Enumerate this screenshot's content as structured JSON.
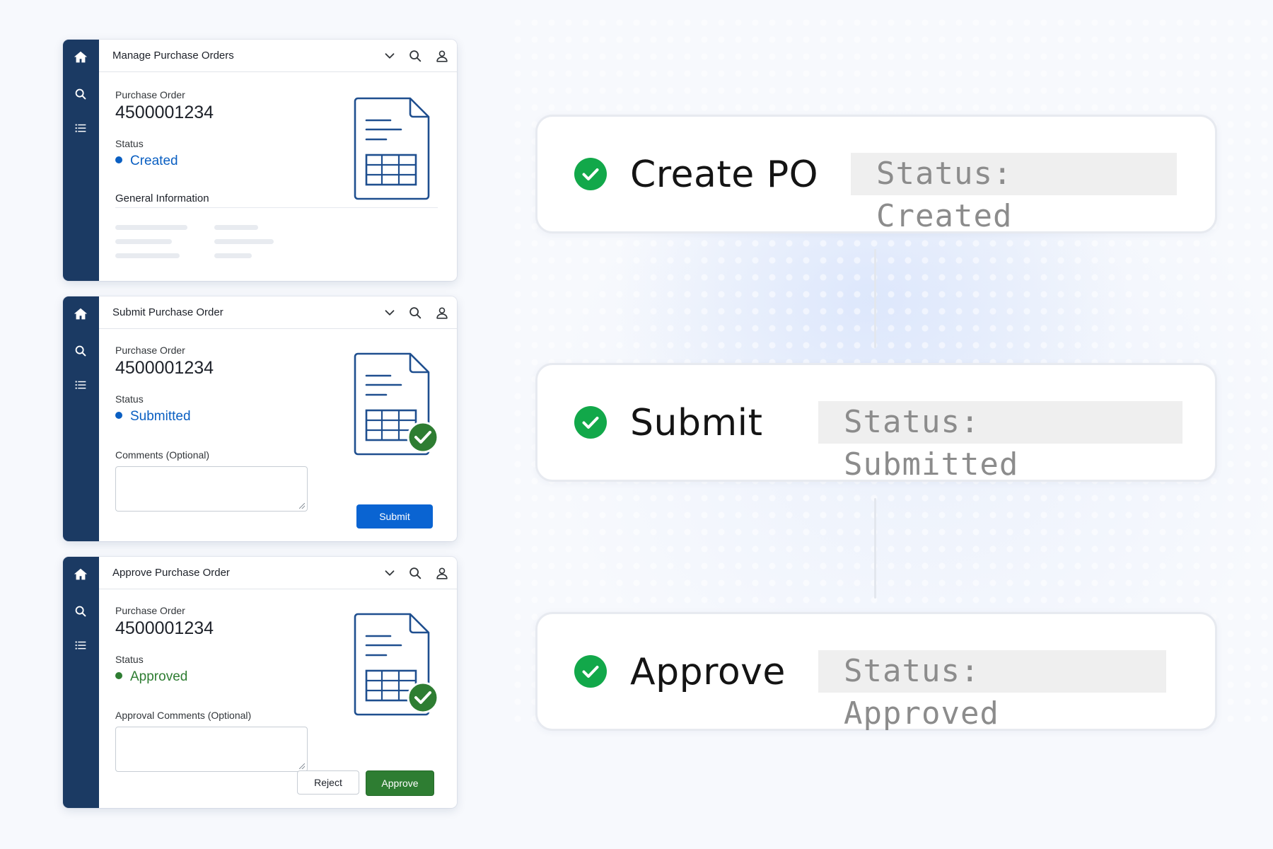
{
  "panels": [
    {
      "header_title": "Manage Purchase Orders",
      "po_label": "Purchase Order",
      "po_number": "4500001234",
      "status_label": "Status",
      "status_value": "Created",
      "section_title": "General Information"
    },
    {
      "header_title": "Submit Purchase Order",
      "po_label": "Purchase Order",
      "po_number": "4500001234",
      "status_label": "Status",
      "status_value": "Submitted",
      "comments_label": "Comments (Optional)",
      "submit_label": "Submit"
    },
    {
      "header_title": "Approve Purchase Order",
      "po_label": "Purchase Order",
      "po_number": "4500001234",
      "status_label": "Status",
      "status_value": "Approved",
      "comments_label": "Approval Comments (Optional)",
      "reject_label": "Reject",
      "approve_label": "Approve"
    }
  ],
  "steps": [
    {
      "title": "Create PO",
      "status_text": "Status: Created"
    },
    {
      "title": "Submit",
      "status_text": "Status: Submitted"
    },
    {
      "title": "Approve",
      "status_text": "Status: Approved"
    }
  ],
  "icons": {
    "rail": [
      "home-icon",
      "search-icon",
      "list-icon"
    ],
    "header": [
      "chevron-down-icon",
      "search-icon",
      "user-icon"
    ],
    "document": "document-table-icon",
    "step_check": "check-circle-icon"
  },
  "colors": {
    "rail": "#1b3a63",
    "status_blue": "#0a5fc2",
    "status_green": "#2e7d32",
    "submit_button": "#0a64d2",
    "approve_button": "#2e7d32",
    "check_green": "#12a84a",
    "document_stroke": "#1f4f8f"
  }
}
